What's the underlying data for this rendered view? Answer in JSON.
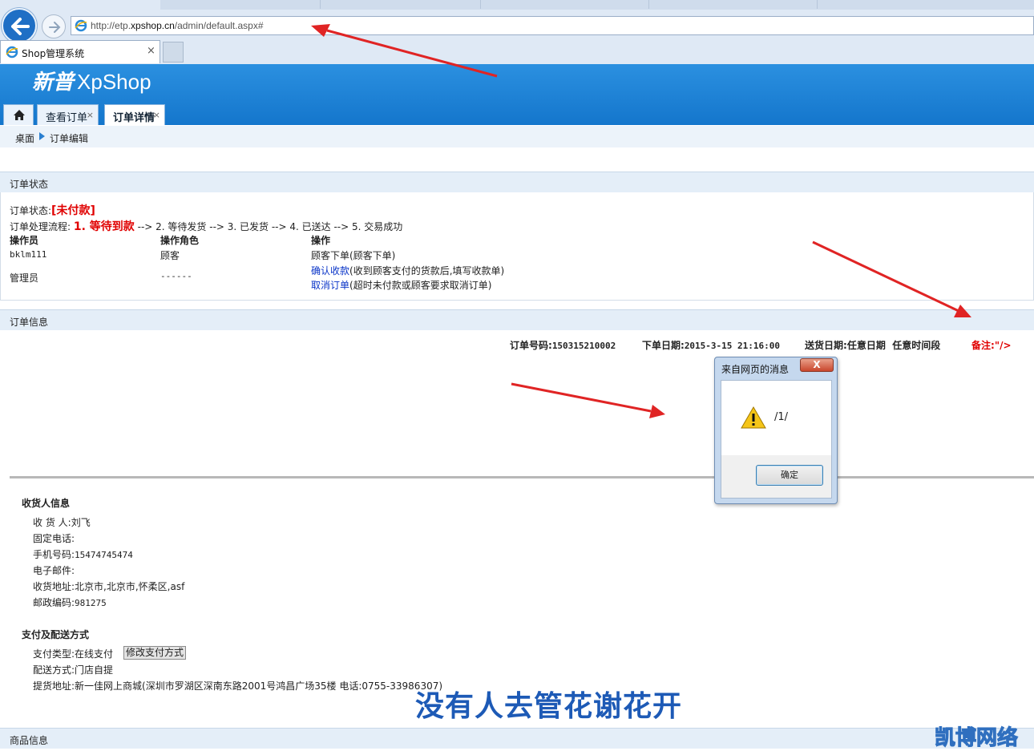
{
  "browser": {
    "url": "http://etp.xpshop.cn/admin/default.aspx#",
    "url_prefix": "http://etp.",
    "url_domain": "xpshop.cn",
    "url_path": "/admin/default.aspx#",
    "tab_title": "Shop管理系统",
    "tab_close": "×"
  },
  "app": {
    "logo_cn": "新普",
    "logo_en": "XpShop",
    "tabs": [
      {
        "label": "查看订单",
        "close": "×"
      },
      {
        "label": "订单详情",
        "close": "×"
      }
    ]
  },
  "breadcrumb": {
    "desk": "桌面",
    "current": "订单编辑"
  },
  "order_status": {
    "section_title": "订单状态",
    "status_label": "订单状态:",
    "status_value": "[未付款]",
    "flow_label": "订单处理流程:",
    "flow_current": "1. 等待到款",
    "flow_rest": "--> 2. 等待发货 --> 3. 已发货 --> 4. 已送达 --> 5. 交易成功",
    "headers": [
      "操作员",
      "操作角色",
      "操作"
    ],
    "rows": [
      {
        "operator": "bklm111",
        "role": "顾客",
        "action": "顾客下单(顾客下单)"
      },
      {
        "operator": "管理员",
        "role": "------",
        "action_link1": "确认收款",
        "action_text1": "(收到顾客支付的货款后,填写收款单)",
        "action_link2": "取消订单",
        "action_text2": "(超时未付款或顾客要求取消订单)"
      }
    ]
  },
  "order_info": {
    "section_title": "订单信息",
    "order_no_label": "订单号码:",
    "order_no": "150315210002",
    "order_date_label": "下单日期:",
    "order_date": "2015-3-15 21:16:00",
    "delivery_label": "送货日期:",
    "delivery_date": "任意日期",
    "delivery_time": "任意时间段",
    "remark_label": "备注:",
    "remark": "\"/>"
  },
  "receiver": {
    "title": "收货人信息",
    "fields": [
      {
        "label": "收 货 人:",
        "value": "刘飞"
      },
      {
        "label": "固定电话:",
        "value": ""
      },
      {
        "label": "手机号码:",
        "value": "15474745474"
      },
      {
        "label": "电子邮件:",
        "value": ""
      },
      {
        "label": "收货地址:",
        "value": "北京市,北京市,怀柔区,asf"
      },
      {
        "label": "邮政编码:",
        "value": "981275"
      }
    ]
  },
  "payment": {
    "title": "支付及配送方式",
    "pay_type_label": "支付类型:",
    "pay_type": "在线支付",
    "change_button": "修改支付方式",
    "ship_label": "配送方式:",
    "ship_value": "门店自提",
    "pickup_label": "提货地址:",
    "pickup_value": "新一佳网上商城(深圳市罗湖区深南东路2001号鸿昌广场35楼 电话:0755-33986307)"
  },
  "next_section_title": "商品信息",
  "dialog": {
    "title": "来自网页的消息",
    "close": "X",
    "message": "/1/",
    "ok": "确定"
  },
  "overlay": {
    "caption": "没有人去管花谢花开",
    "watermark": "凯博网络",
    "arrow_color": "#e02424"
  }
}
